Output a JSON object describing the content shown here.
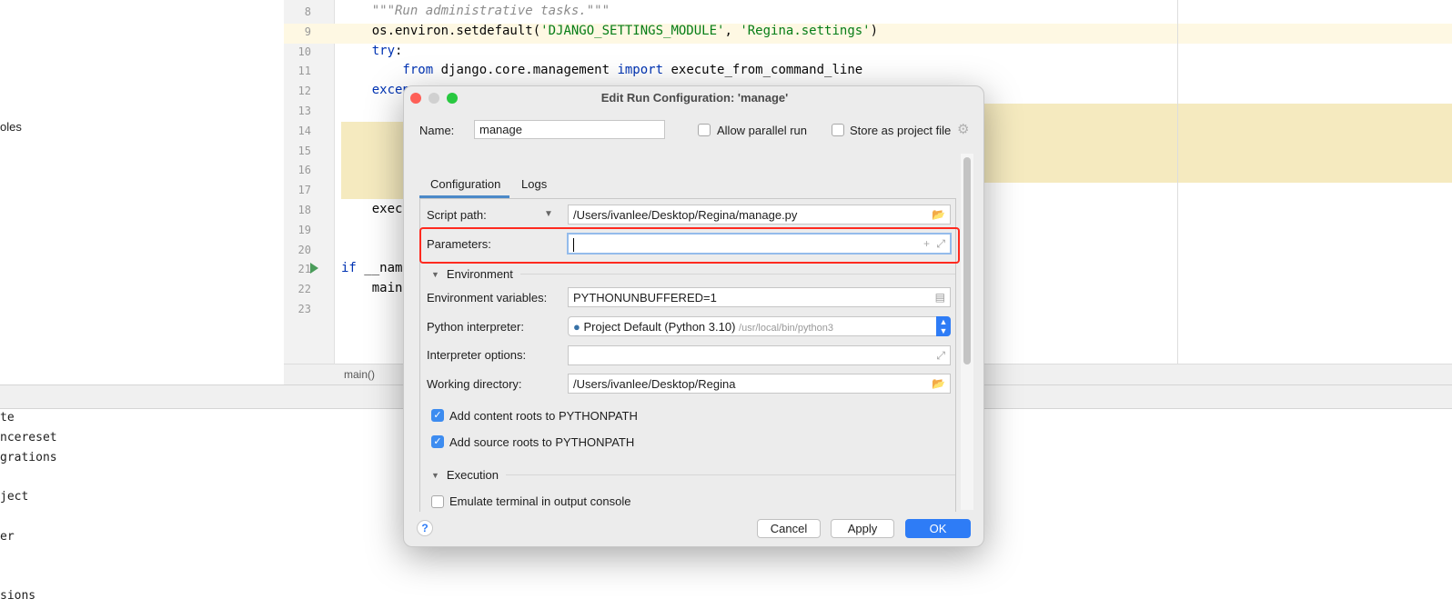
{
  "left_panel": {
    "items": [
      "oles"
    ]
  },
  "editor": {
    "lines": [
      {
        "n": "8",
        "parts": [
          {
            "t": "    \"\"\"Run administrative tasks.\"\"\"",
            "c": "doc"
          }
        ]
      },
      {
        "n": "9",
        "parts": [
          {
            "t": "    os.environ.setdefault(",
            "c": ""
          },
          {
            "t": "'DJANGO_SETTINGS_MODULE'",
            "c": "str"
          },
          {
            "t": ", ",
            "c": ""
          },
          {
            "t": "'Regina.settings'",
            "c": "str"
          },
          {
            "t": ")",
            "c": ""
          }
        ]
      },
      {
        "n": "10",
        "parts": [
          {
            "t": "    try",
            "c": "kw"
          },
          {
            "t": ":",
            "c": ""
          }
        ]
      },
      {
        "n": "11",
        "parts": [
          {
            "t": "        from",
            "c": "kw"
          },
          {
            "t": " django.core.management ",
            "c": ""
          },
          {
            "t": "import",
            "c": "kw"
          },
          {
            "t": " execute_from_command_line",
            "c": ""
          }
        ]
      },
      {
        "n": "12",
        "parts": [
          {
            "t": "    excep",
            "c": "kw"
          }
        ]
      },
      {
        "n": "13",
        "parts": [
          {
            "t": "        r",
            "c": "kw"
          }
        ]
      },
      {
        "n": "14",
        "parts": []
      },
      {
        "n": "15",
        "parts": []
      },
      {
        "n": "16",
        "parts": []
      },
      {
        "n": "17",
        "parts": [
          {
            "t": "        )",
            "c": ""
          }
        ]
      },
      {
        "n": "18",
        "parts": [
          {
            "t": "    execu",
            "c": ""
          }
        ]
      },
      {
        "n": "19",
        "parts": []
      },
      {
        "n": "20",
        "parts": []
      },
      {
        "n": "21",
        "parts": [
          {
            "t": "if",
            "c": "kw"
          },
          {
            "t": " __name",
            "c": ""
          }
        ]
      },
      {
        "n": "22",
        "parts": [
          {
            "t": "    main(",
            "c": ""
          }
        ]
      },
      {
        "n": "23",
        "parts": []
      }
    ],
    "breadcrumb": "main()"
  },
  "run_panel": {
    "lines": [
      "te",
      "ncereset",
      "grations",
      "",
      "ject",
      "",
      "er",
      "",
      "",
      "sions"
    ]
  },
  "dialog": {
    "title": "Edit Run Configuration: 'manage'",
    "name_label": "Name:",
    "name_value": "manage",
    "allow_parallel_label": "Allow parallel run",
    "allow_parallel": false,
    "store_project_label": "Store as project file",
    "store_project": false,
    "tabs": [
      {
        "label": "Configuration",
        "active": true
      },
      {
        "label": "Logs",
        "active": false
      }
    ],
    "script_path_label": "Script path:",
    "script_path": "/Users/ivanlee/Desktop/Regina/manage.py",
    "parameters_label": "Parameters:",
    "parameters": "",
    "environment_section": "Environment",
    "env_vars_label": "Environment variables:",
    "env_vars": "PYTHONUNBUFFERED=1",
    "interpreter_label": "Python interpreter:",
    "interpreter": "Project Default (Python 3.10)",
    "interpreter_path": "/usr/local/bin/python3",
    "interp_options_label": "Interpreter options:",
    "interp_options": "",
    "workdir_label": "Working directory:",
    "workdir": "/Users/ivanlee/Desktop/Regina",
    "content_roots_label": "Add content roots to PYTHONPATH",
    "content_roots": true,
    "source_roots_label": "Add source roots to PYTHONPATH",
    "source_roots": true,
    "execution_section": "Execution",
    "emulate_label": "Emulate terminal in output console",
    "emulate": false,
    "help": "?",
    "cancel": "Cancel",
    "apply": "Apply",
    "ok": "OK"
  },
  "colors": {
    "accent": "#3d8cf0",
    "highlight_box": "#ff2a1f",
    "line_highlight": "#fef8e3",
    "block_highlight": "#f5eabf"
  }
}
